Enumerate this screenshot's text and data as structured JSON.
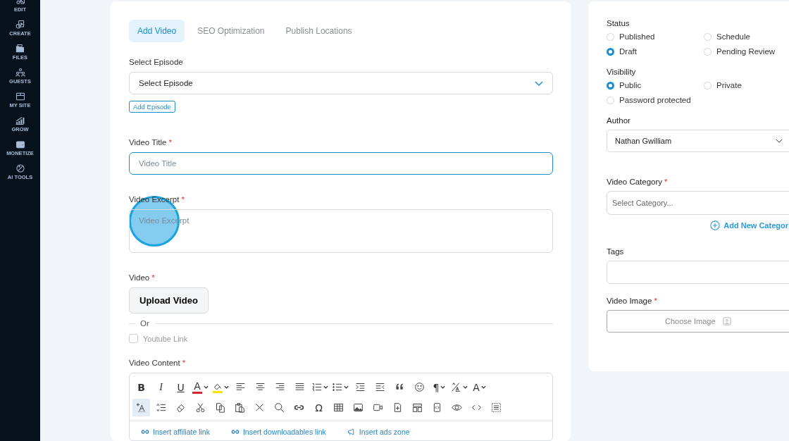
{
  "sidebar": {
    "items": [
      {
        "label": "EDIT",
        "kind": "edit"
      },
      {
        "label": "CREATE",
        "kind": "create"
      },
      {
        "label": "FILES",
        "kind": "files"
      },
      {
        "label": "GUESTS",
        "kind": "guests"
      },
      {
        "label": "MY SITE",
        "kind": "site"
      },
      {
        "label": "GROW",
        "kind": "grow"
      },
      {
        "label": "MONETIZE",
        "kind": "monetize"
      },
      {
        "label": "AI TOOLS",
        "kind": "ai"
      }
    ]
  },
  "tabs": [
    {
      "label": "Add Video",
      "selected": true
    },
    {
      "label": "SEO Optimization",
      "selected": false
    },
    {
      "label": "Publish Locations",
      "selected": false
    }
  ],
  "episode": {
    "label": "Select Episode",
    "value": "Select Episode",
    "add_button": "Add Episode"
  },
  "title_field": {
    "label": "Video Title",
    "required_mark": "*",
    "placeholder": "Video Title"
  },
  "excerpt_field": {
    "label": "Video Excerpt",
    "required_mark": "*",
    "placeholder": "Video Excerpt"
  },
  "video": {
    "label": "Video",
    "required_mark": "*",
    "upload_button": "Upload Video",
    "divider_text": "Or",
    "youtube": {
      "label": "Youtube Link",
      "checked": false
    }
  },
  "content": {
    "label": "Video Content",
    "required_mark": "*",
    "toolbar_rows": [
      [
        {
          "kind": "bold",
          "label": "B"
        },
        {
          "kind": "italic",
          "label": "I"
        },
        {
          "kind": "underline",
          "label": "U"
        },
        {
          "kind": "font-color",
          "label": "A",
          "dropdown": true,
          "color": "#d9262b"
        },
        {
          "kind": "highlight",
          "dropdown": true,
          "color": "#f5e400"
        },
        {
          "kind": "align-left"
        },
        {
          "kind": "align-center"
        },
        {
          "kind": "align-right"
        },
        {
          "kind": "justify"
        },
        {
          "kind": "ordered-list",
          "dropdown": true
        },
        {
          "kind": "bullet-list",
          "dropdown": true
        },
        {
          "kind": "indent"
        },
        {
          "kind": "outdent"
        },
        {
          "kind": "quote"
        },
        {
          "kind": "emoji"
        },
        {
          "kind": "paragraph",
          "label": "¶",
          "dropdown": true
        },
        {
          "kind": "text-direction",
          "dropdown": true
        },
        {
          "kind": "font-size",
          "label": "A",
          "dropdown": true
        }
      ],
      [
        {
          "kind": "add-text",
          "selected": true
        },
        {
          "kind": "line-height"
        },
        {
          "kind": "eraser"
        },
        {
          "kind": "cut"
        },
        {
          "kind": "copy"
        },
        {
          "kind": "paste"
        },
        {
          "kind": "remove"
        },
        {
          "kind": "search"
        },
        {
          "kind": "link"
        },
        {
          "kind": "omega",
          "label": "Ω"
        },
        {
          "kind": "table"
        },
        {
          "kind": "image"
        },
        {
          "kind": "video"
        },
        {
          "kind": "file-add"
        },
        {
          "kind": "layout"
        },
        {
          "kind": "code-block"
        },
        {
          "kind": "preview"
        },
        {
          "kind": "source"
        },
        {
          "kind": "select-all"
        }
      ]
    ],
    "links": [
      {
        "kind": "link",
        "label": "Insert affiliate link"
      },
      {
        "kind": "link",
        "label": "Insert downloadables link"
      },
      {
        "kind": "megaphone",
        "label": "Insert ads zone"
      }
    ]
  },
  "status": {
    "label": "Status",
    "options": [
      {
        "label": "Published",
        "selected": false
      },
      {
        "label": "Schedule",
        "selected": false
      },
      {
        "label": "Draft",
        "selected": true
      },
      {
        "label": "Pending Review",
        "selected": false
      }
    ]
  },
  "visibility": {
    "label": "Visibility",
    "options": [
      {
        "label": "Public",
        "selected": true
      },
      {
        "label": "Private",
        "selected": false
      },
      {
        "label": "Password protected",
        "selected": false
      }
    ]
  },
  "author": {
    "label": "Author",
    "value": "Nathan Gwilliam"
  },
  "category": {
    "label": "Video Category",
    "required_mark": "*",
    "placeholder": "Select Category...",
    "add_link": "Add New Categor"
  },
  "tags": {
    "label": "Tags"
  },
  "image": {
    "label": "Video Image",
    "required_mark": "*",
    "button": "Choose Image"
  }
}
